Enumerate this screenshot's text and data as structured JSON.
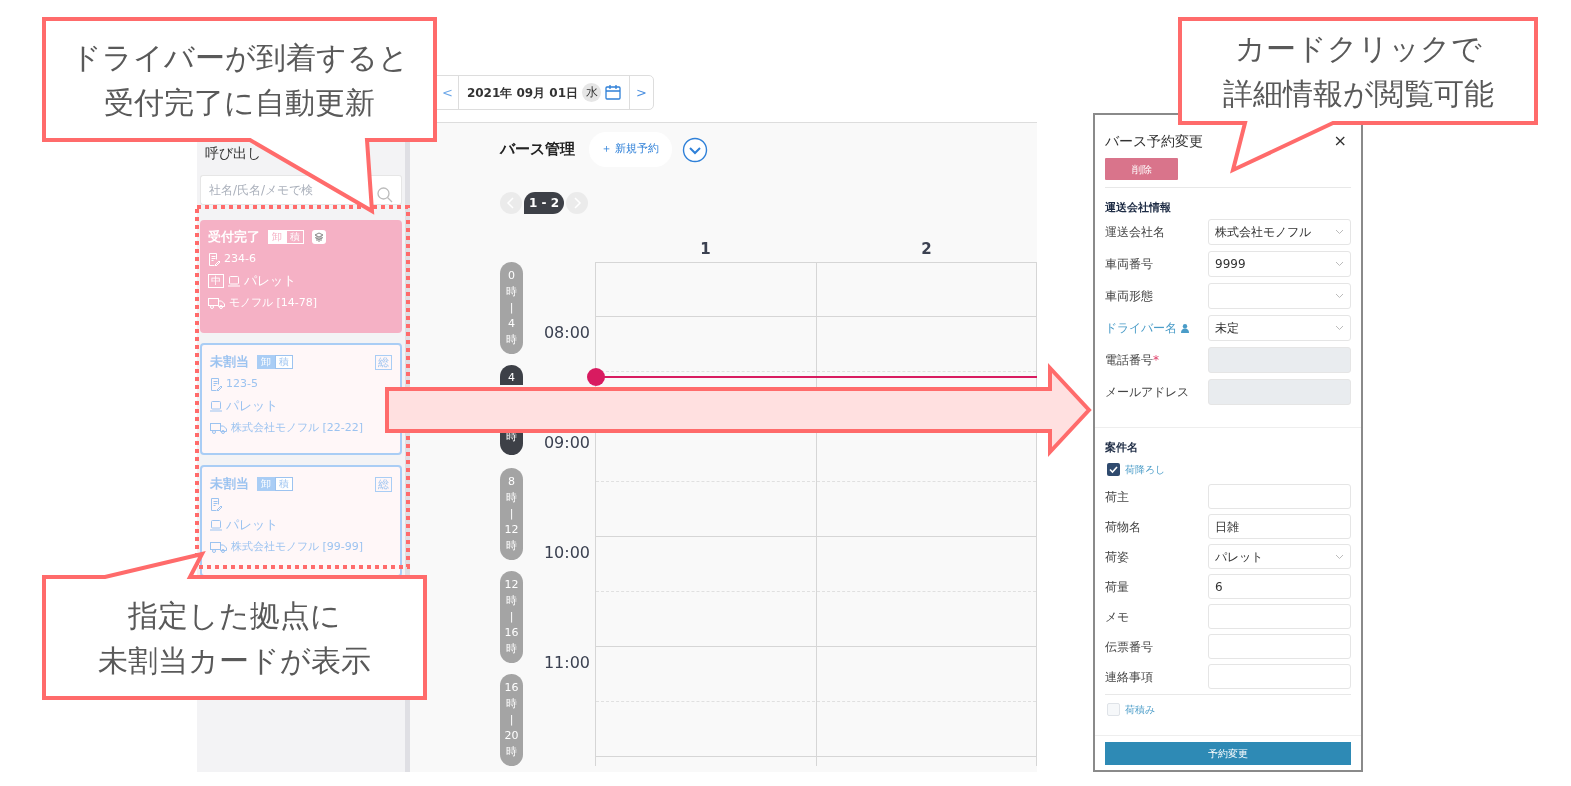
{
  "date_nav": {
    "prev": "<",
    "date": "2021年 09月 01日",
    "weekday": "水",
    "next": ">"
  },
  "sidebar": {
    "title": "呼び出し",
    "search": {
      "placeholder": "社名/氏名/メモで検"
    },
    "cards": [
      {
        "kind": "received",
        "status": "受付完了",
        "tags": [
          {
            "label": "卸",
            "selected": true
          },
          {
            "label": "積",
            "selected": false
          }
        ],
        "slip": "234-6",
        "size": "中",
        "cargo": "パレット",
        "carrier": "モノフル [14-78]"
      },
      {
        "kind": "unassigned",
        "status": "未割当",
        "tags": [
          {
            "label": "卸",
            "selected": true
          },
          {
            "label": "積",
            "selected": false
          }
        ],
        "badge": "総",
        "slip": "123-5",
        "cargo": "パレット",
        "carrier": "株式会社モノフル [22-22]"
      },
      {
        "kind": "unassigned",
        "status": "未割当",
        "tags": [
          {
            "label": "卸",
            "selected": true
          },
          {
            "label": "積",
            "selected": false
          }
        ],
        "badge": "総",
        "cargo": "パレット",
        "carrier": "株式会社モノフル [99-99]"
      }
    ]
  },
  "berth": {
    "title": "バース管理",
    "new_button": "＋ 新規予約",
    "pager": "1 - 2",
    "columns": [
      "1",
      "2"
    ],
    "time_ranges": [
      {
        "lines": [
          "0",
          "時",
          "|",
          "4",
          "時"
        ],
        "selected": false
      },
      {
        "lines": [
          "4"
        ],
        "end_lines": [
          "時"
        ],
        "selected": true
      },
      {
        "lines": [
          "8",
          "時",
          "|",
          "12",
          "時"
        ],
        "selected": false
      },
      {
        "lines": [
          "12",
          "時",
          "|",
          "16",
          "時"
        ],
        "selected": false
      },
      {
        "lines": [
          "16",
          "時",
          "|",
          "20",
          "時"
        ],
        "selected": false
      }
    ],
    "hours": [
      "08:00",
      "09:00",
      "10:00",
      "11:00"
    ]
  },
  "modal": {
    "title": "バース予約変更",
    "close": "×",
    "delete_button": "削除",
    "sections": [
      {
        "heading": "運送会社情報",
        "rows": [
          {
            "kind": "select",
            "label": "運送会社名",
            "value": "株式会社モノフル"
          },
          {
            "kind": "select",
            "label": "車両番号",
            "value": "9999"
          },
          {
            "kind": "select",
            "label": "車両形態"
          },
          {
            "kind": "driver",
            "label": "ドライバー名",
            "value": "未定"
          },
          {
            "kind": "readonly",
            "label": "電話番号",
            "required_mark": "*"
          },
          {
            "kind": "readonly",
            "label": "メールアドレス"
          }
        ]
      },
      {
        "heading": "案件名",
        "rows": [
          {
            "kind": "checkbox",
            "label": "荷降ろし",
            "checked": true
          },
          {
            "kind": "input",
            "label": "荷主"
          },
          {
            "kind": "input",
            "label": "荷物名",
            "value": "日雑"
          },
          {
            "kind": "select",
            "label": "荷姿",
            "value": "パレット"
          },
          {
            "kind": "input",
            "label": "荷量",
            "value": "6"
          },
          {
            "kind": "input",
            "label": "メモ"
          },
          {
            "kind": "input",
            "label": "伝票番号"
          },
          {
            "kind": "input",
            "label": "連絡事項"
          },
          {
            "kind": "checkbox",
            "label": "荷積み",
            "checked": false
          }
        ]
      }
    ],
    "submit": "予約変更"
  },
  "callouts": [
    {
      "lines": [
        "ドライバーが到着すると",
        "受付完了に自動更新"
      ]
    },
    {
      "lines": [
        "指定した拠点に",
        "未割当カードが表示"
      ]
    },
    {
      "lines": [
        "カードクリックで",
        "詳細情報が閲覧可能"
      ]
    }
  ]
}
